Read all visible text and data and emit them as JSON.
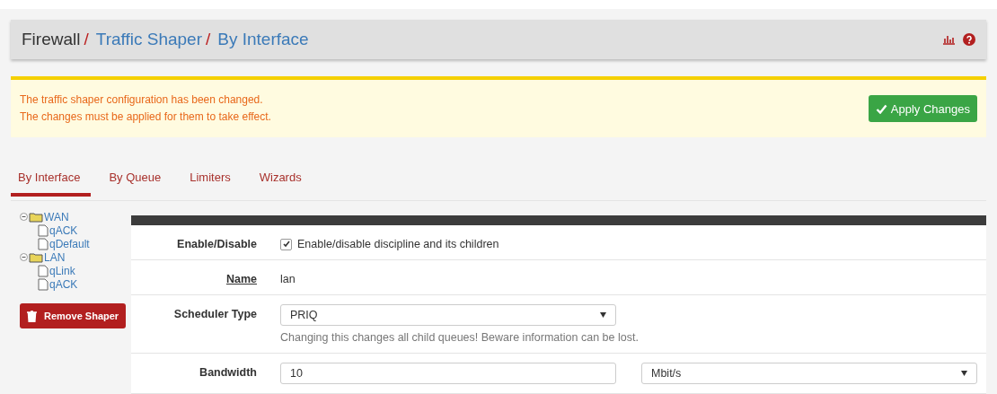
{
  "breadcrumb": [
    "Firewall",
    "Traffic Shaper",
    "By Interface"
  ],
  "breadcrumb_separator": "/",
  "alert": {
    "lines": [
      "The traffic shaper configuration has been changed.",
      "The changes must be applied for them to take effect."
    ],
    "button": "Apply Changes"
  },
  "tabs": [
    {
      "label": "By Interface",
      "selected": true
    },
    {
      "label": "By Queue",
      "selected": false
    },
    {
      "label": "Limiters",
      "selected": false
    },
    {
      "label": "Wizards",
      "selected": false
    }
  ],
  "tree": [
    {
      "label": "WAN",
      "expanded": true,
      "children": [
        {
          "label": "qACK"
        },
        {
          "label": "qDefault"
        }
      ]
    },
    {
      "label": "LAN",
      "expanded": true,
      "children": [
        {
          "label": "qLink"
        },
        {
          "label": "qACK"
        }
      ]
    }
  ],
  "remove_button": "Remove Shaper",
  "form": [
    {
      "kind": "checkbox",
      "label": "Enable/Disable",
      "checked": true,
      "text": "Enable/disable discipline and its children"
    },
    {
      "kind": "text",
      "label": "Name",
      "value": "lan"
    },
    {
      "kind": "select",
      "label": "Scheduler Type",
      "value": "PRIQ",
      "help": "Changing this changes all child queues! Beware information can be lost."
    },
    {
      "kind": "bandwidth",
      "label": "Bandwidth",
      "value": "10",
      "unit": "Mbit/s"
    }
  ]
}
